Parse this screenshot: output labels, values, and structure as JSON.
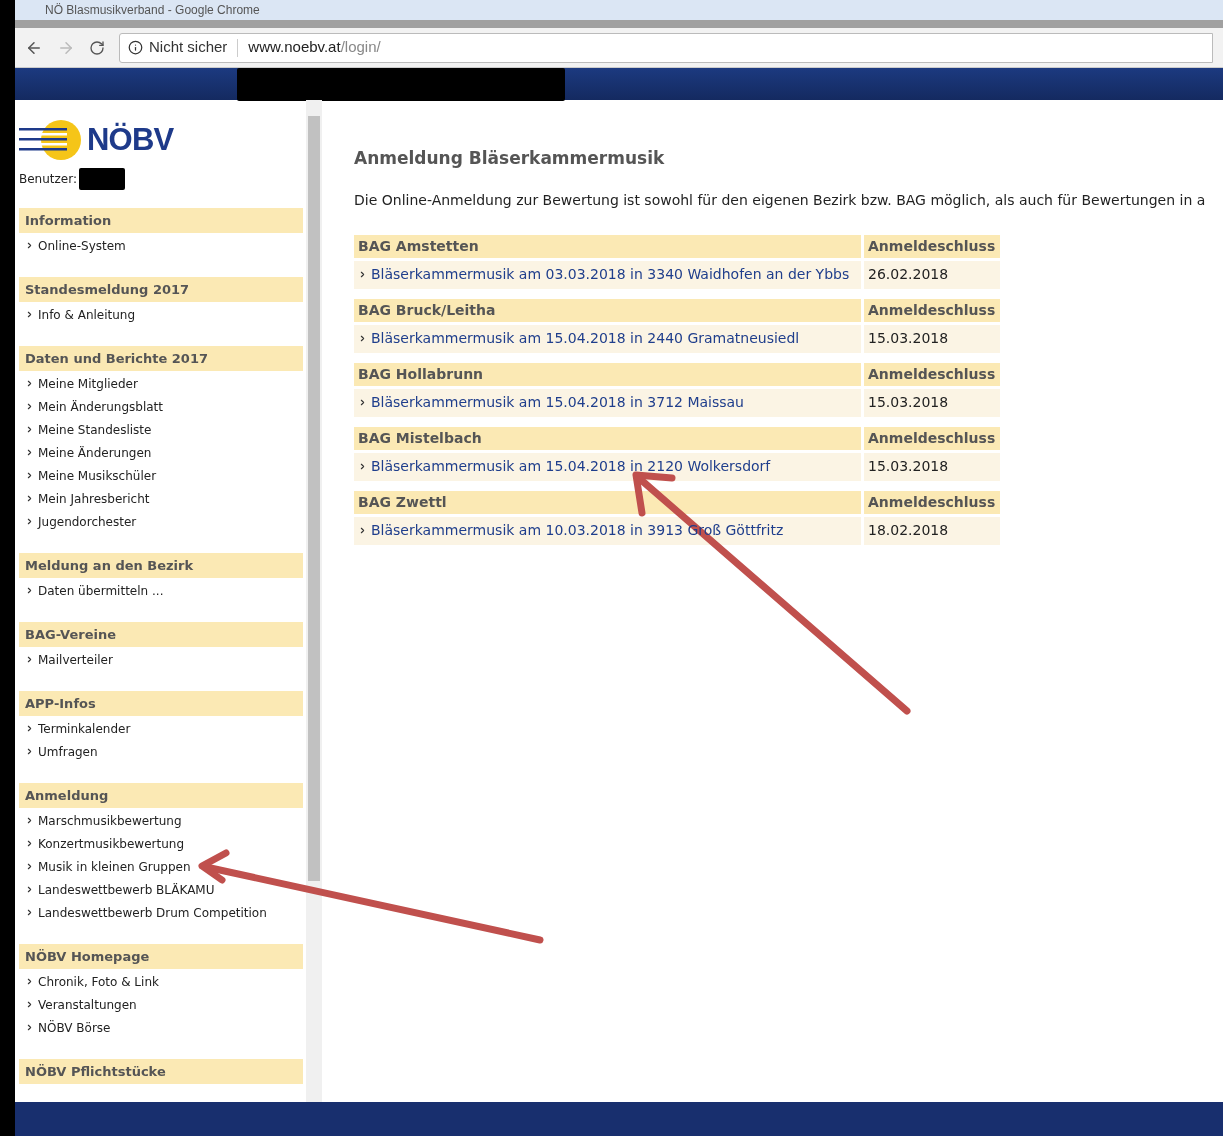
{
  "window": {
    "title": "NÖ Blasmusikverband - Google Chrome"
  },
  "address_bar": {
    "security": "Nicht sicher",
    "host": "www.noebv.at",
    "path": "/login/"
  },
  "logo": {
    "text": "NÖBV"
  },
  "user_label": "Benutzer:",
  "sidebar": [
    {
      "title": "Information",
      "items": [
        "Online-System"
      ]
    },
    {
      "title": "Standesmeldung 2017",
      "items": [
        "Info & Anleitung"
      ]
    },
    {
      "title": "Daten und Berichte 2017",
      "items": [
        "Meine Mitglieder",
        "Mein Änderungsblatt",
        "Meine Standesliste",
        "Meine Änderungen",
        "Meine Musikschüler",
        "Mein Jahresbericht",
        "Jugendorchester"
      ]
    },
    {
      "title": "Meldung an den Bezirk",
      "items": [
        "Daten übermitteln ..."
      ]
    },
    {
      "title": "BAG-Vereine",
      "items": [
        "Mailverteiler"
      ]
    },
    {
      "title": "APP-Infos",
      "items": [
        "Terminkalender",
        "Umfragen"
      ]
    },
    {
      "title": "Anmeldung",
      "items": [
        "Marschmusikbewertung",
        "Konzertmusikbewertung",
        "Musik in kleinen Gruppen",
        "Landeswettbewerb BLÄKAMU",
        "Landeswettbewerb Drum Competition"
      ]
    },
    {
      "title": "NÖBV Homepage",
      "items": [
        "Chronik, Foto & Link",
        "Veranstaltungen",
        "NÖBV Börse"
      ]
    },
    {
      "title": "NÖBV Pflichtstücke"
    }
  ],
  "page": {
    "heading": "Anmeldung Bläserkammermusik",
    "intro": "Die Online-Anmeldung zur Bewertung ist sowohl für den eigenen Bezirk bzw. BAG möglich, als auch für Bewertungen in a",
    "groups": [
      {
        "name": "BAG Amstetten",
        "deadline_heading": "Anmeldeschluss",
        "event": "Bläserkammermusik am 03.03.2018 in 3340 Waidhofen an der Ybbs",
        "deadline": "26.02.2018"
      },
      {
        "name": "BAG Bruck/Leitha",
        "deadline_heading": "Anmeldeschluss",
        "event": "Bläserkammermusik am 15.04.2018 in 2440 Gramatneusiedl",
        "deadline": "15.03.2018"
      },
      {
        "name": "BAG Hollabrunn",
        "deadline_heading": "Anmeldeschluss",
        "event": "Bläserkammermusik am 15.04.2018 in 3712 Maissau",
        "deadline": "15.03.2018"
      },
      {
        "name": "BAG Mistelbach",
        "deadline_heading": "Anmeldeschluss",
        "event": "Bläserkammermusik am 15.04.2018 in 2120 Wolkersdorf",
        "deadline": "15.03.2018"
      },
      {
        "name": "BAG Zwettl",
        "deadline_heading": "Anmeldeschluss",
        "event": "Bläserkammermusik am 10.03.2018 in 3913 Groß Göttfritz",
        "deadline": "18.02.2018"
      }
    ]
  }
}
